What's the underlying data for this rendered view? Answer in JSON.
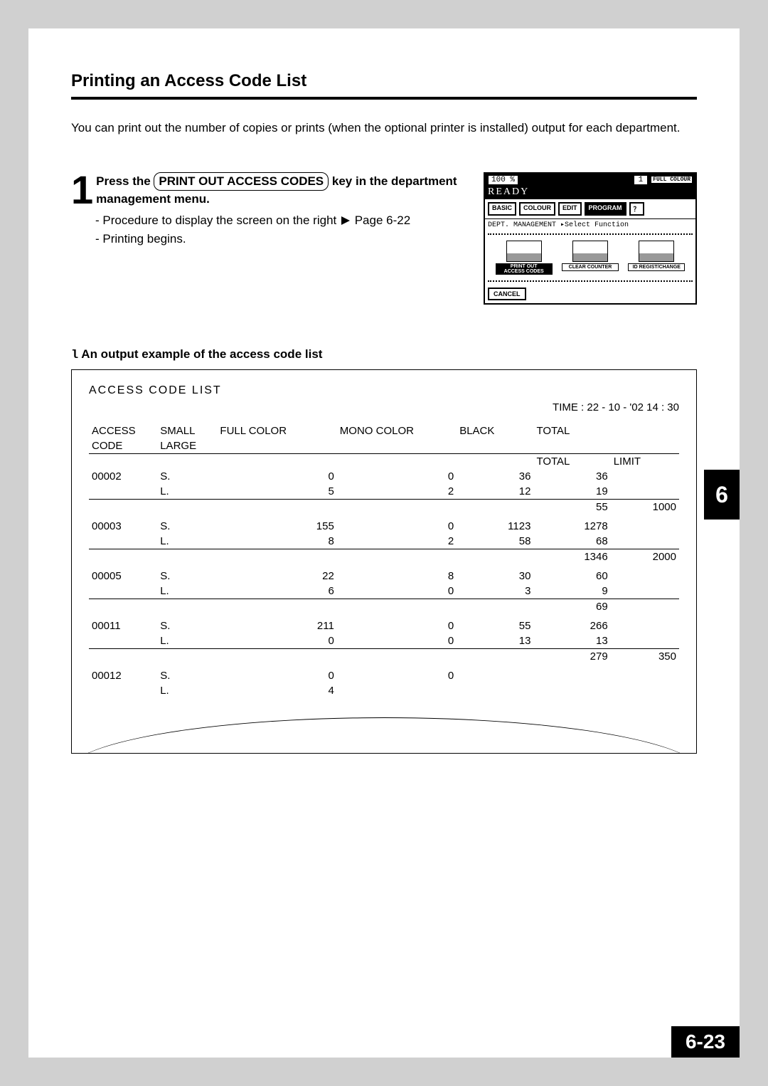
{
  "title": "Printing an Access Code List",
  "intro": "You can print out the number of copies or prints (when the optional printer is installed) output for each department.",
  "step": {
    "number": "1",
    "lead_in": "Press the ",
    "key_label": "PRINT OUT ACCESS CODES",
    "tail": " key in the department management menu.",
    "sub_a_prefix": "- Procedure to display the screen on the right ",
    "sub_a_pageref": "Page 6-22",
    "sub_b": "- Printing begins."
  },
  "screen": {
    "zoom": "100 %",
    "count": "1",
    "mode": "FULL COLOUR",
    "ready": "READY",
    "tabs": [
      "BASIC",
      "COLOUR",
      "EDIT",
      "PROGRAM"
    ],
    "breadcrumb": "DEPT. MANAGEMENT ▸Select Function",
    "funcs": [
      {
        "label_top": "PRINT OUT",
        "label_bot": "ACCESS CODES",
        "highlight": true
      },
      {
        "label_top": "CLEAR COUNTER",
        "label_bot": "",
        "highlight": false
      },
      {
        "label_top": "ID REGIST/CHANGE",
        "label_bot": "",
        "highlight": false
      }
    ],
    "cancel": "CANCEL"
  },
  "example": {
    "marker": "l",
    "heading": "An output example of the access code list",
    "list_title": "ACCESS  CODE  LIST",
    "time": "TIME  :  22 - 10 - '02  14 : 30",
    "headers": {
      "access_code": "ACCESS",
      "code": "CODE",
      "small": "SMALL",
      "large": "LARGE",
      "full_color": "FULL COLOR",
      "mono_color": "MONO COLOR",
      "black": "BLACK",
      "total": "TOTAL",
      "limit": "LIMIT"
    },
    "rows": [
      {
        "code": "00002",
        "s": {
          "full": "0",
          "mono": "0",
          "black": "36",
          "total": "36"
        },
        "l": {
          "full": "5",
          "mono": "2",
          "black": "12",
          "total": "19"
        },
        "grand": "55",
        "limit": "1000"
      },
      {
        "code": "00003",
        "s": {
          "full": "155",
          "mono": "0",
          "black": "1123",
          "total": "1278"
        },
        "l": {
          "full": "8",
          "mono": "2",
          "black": "58",
          "total": "68"
        },
        "grand": "1346",
        "limit": "2000"
      },
      {
        "code": "00005",
        "s": {
          "full": "22",
          "mono": "8",
          "black": "30",
          "total": "60"
        },
        "l": {
          "full": "6",
          "mono": "0",
          "black": "3",
          "total": "9"
        },
        "grand": "69",
        "limit": ""
      },
      {
        "code": "00011",
        "s": {
          "full": "211",
          "mono": "0",
          "black": "55",
          "total": "266"
        },
        "l": {
          "full": "0",
          "mono": "0",
          "black": "13",
          "total": "13"
        },
        "grand": "279",
        "limit": "350"
      },
      {
        "code": "00012",
        "s": {
          "full": "0",
          "mono": "0",
          "black": "",
          "total": ""
        },
        "l": {
          "full": "4",
          "mono": "",
          "black": "",
          "total": ""
        },
        "grand": "",
        "limit": ""
      }
    ]
  },
  "chapter_tab": "6",
  "page_number": "6-23"
}
